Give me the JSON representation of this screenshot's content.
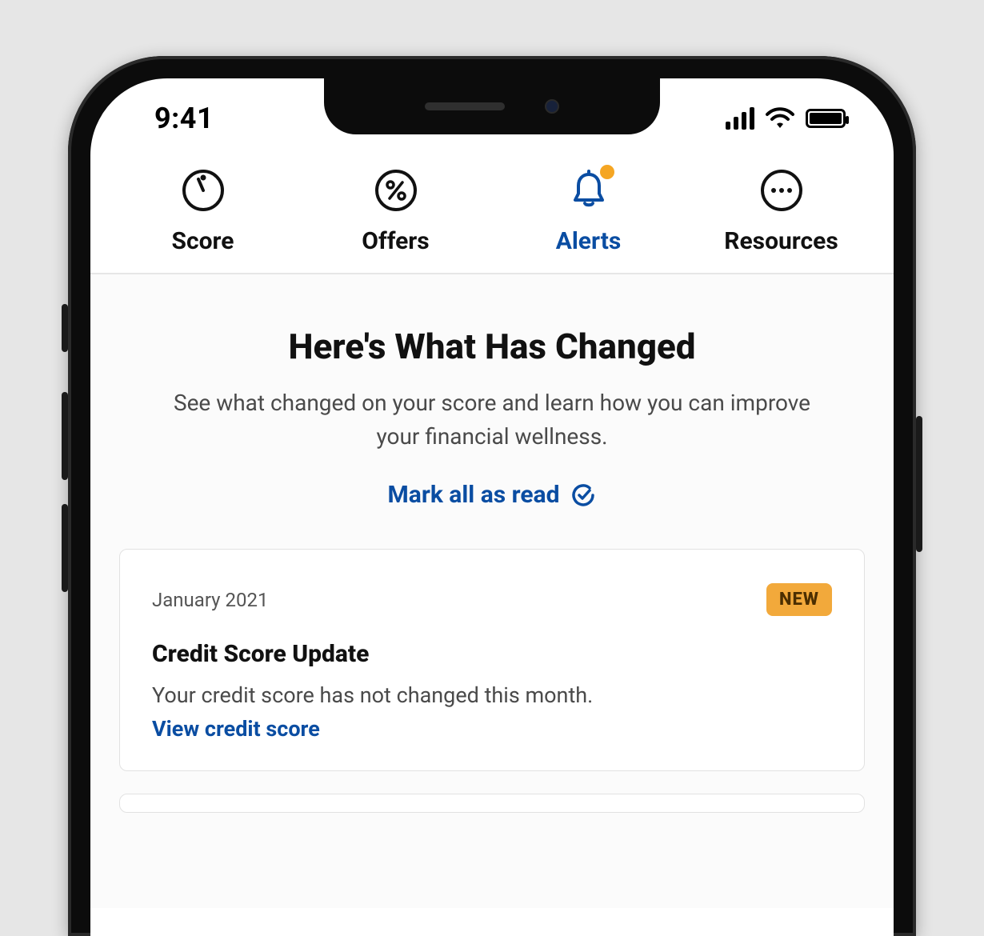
{
  "status_bar": {
    "time": "9:41"
  },
  "tabs": [
    {
      "label": "Score"
    },
    {
      "label": "Offers"
    },
    {
      "label": "Alerts",
      "active": true,
      "has_notification": true
    },
    {
      "label": "Resources"
    }
  ],
  "page": {
    "heading": "Here's What Has Changed",
    "subheading": "See what changed on your score and learn how you can improve your financial wellness.",
    "mark_all_read": "Mark all as read"
  },
  "alerts": [
    {
      "date": "January 2021",
      "badge": "NEW",
      "title": "Credit Score Update",
      "body": "Your credit score has not changed this month.",
      "link": "View credit score"
    }
  ],
  "colors": {
    "accent": "#0a4da2",
    "badge_bg": "#f2a93b",
    "notification_dot": "#f5a623"
  }
}
